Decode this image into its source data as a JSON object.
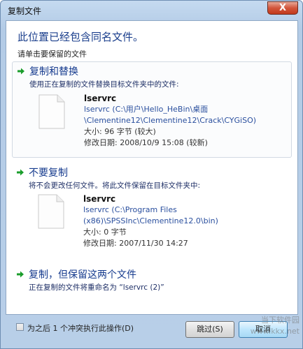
{
  "window": {
    "title": "复制文件",
    "close_symbol": "X"
  },
  "heading": "此位置已经包含同名文件。",
  "subheading": "请单击要保留的文件",
  "options": [
    {
      "title": "复制和替换",
      "desc": "使用正在复制的文件替换目标文件夹中的文件:",
      "file": {
        "name": "lservrc",
        "path_lines": [
          "lservrc (C:\\用户\\Hello_HeBin\\桌面",
          "\\Clementine12\\Clementine12\\Crack\\CYGiSO)"
        ],
        "size": "大小: 96 字节 (较大)",
        "modified": "修改日期: 2008/10/9 15:08 (较新)"
      }
    },
    {
      "title": "不要复制",
      "desc": "将不会更改任何文件。将此文件保留在目标文件夹中:",
      "file": {
        "name": "lservrc",
        "path_lines": [
          "lservrc (C:\\Program Files",
          "(x86)\\SPSSInc\\Clementine12.0\\bin)"
        ],
        "size": "大小: 0 字节",
        "modified": "修改日期: 2007/11/30 14:27"
      }
    },
    {
      "title": "复制，但保留这两个文件",
      "desc": "正在复制的文件将重命名为 “lservrc (2)”"
    }
  ],
  "footer": {
    "apply_all_label": "为之后 1 个冲突执行此操作(D)",
    "skip_label": "跳过(S)",
    "cancel_label": "取消"
  },
  "watermark": {
    "line1": "当下软件园",
    "line2": "www.kkx.net"
  }
}
